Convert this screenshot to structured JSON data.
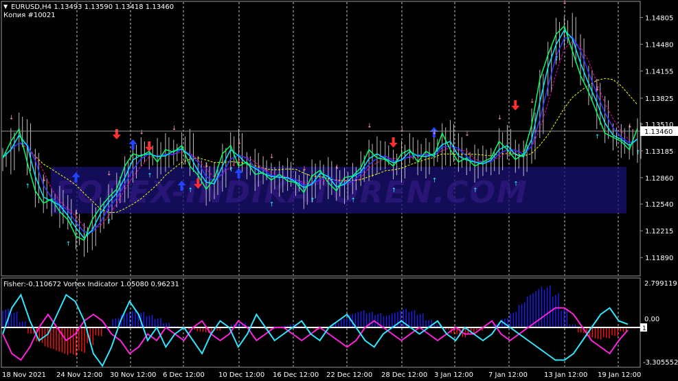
{
  "window": {
    "symbol_header": "EURUSD,H4  1.13493 1.13590 1.13418 1.13460",
    "copy_label": "Копия #10021",
    "current_price": "1.13460",
    "watermark": "FOREX-INDIKATOREN.COM"
  },
  "price_axis": [
    "1.14805",
    "1.14480",
    "1.14155",
    "1.13825",
    "1.13510",
    "1.13185",
    "1.12860",
    "1.12540",
    "1.12215",
    "1.11890"
  ],
  "indicator": {
    "header": "Fisher:-0.110672  Vortex Indicator 1.05080 0.96231",
    "axis": [
      "2.799119",
      "0.00",
      "1",
      "-3.305552"
    ]
  },
  "time_axis": [
    "18 Nov 2021",
    "24 Nov 12:00",
    "30 Nov 12:00",
    "6 Dec 12:00",
    "10 Dec 12:00",
    "16 Dec 12:00",
    "22 Dec 12:00",
    "28 Dec 12:00",
    "3 Jan 12:00",
    "7 Jan 12:00",
    "13 Jan 12:00",
    "19 Jan 12:00"
  ],
  "colors": {
    "background": "#000000",
    "grid": "#c8c8c8",
    "candles": "#bfbfbf",
    "ma_fast": "#00ff66",
    "ma_mid": "#00e5ff",
    "ma_slow": "#ffff00",
    "ma_pink": "#ff00aa",
    "ma_blue": "#3333ff",
    "fisher_up": "#1e1eff",
    "fisher_down": "#ff1111",
    "vortex_plus": "#33e6ff",
    "vortex_minus": "#ff22dd",
    "arrow_sell": "#ff3030",
    "arrow_buy": "#2244ff",
    "small_arrow_up": "#33e6ff",
    "small_arrow_down": "#ff99aa"
  },
  "chart_data": {
    "type": "line",
    "title": "EURUSD,H4",
    "ylim": [
      1.117,
      1.1495
    ],
    "close": [
      1.131,
      1.133,
      1.1345,
      1.1305,
      1.127,
      1.1255,
      1.126,
      1.1245,
      1.1235,
      1.1215,
      1.121,
      1.1235,
      1.125,
      1.1262,
      1.1272,
      1.13,
      1.1315,
      1.1312,
      1.1318,
      1.1305,
      1.132,
      1.1317,
      1.1325,
      1.13,
      1.1289,
      1.1272,
      1.1285,
      1.1315,
      1.1325,
      1.13,
      1.1305,
      1.129,
      1.1292,
      1.1283,
      1.129,
      1.1282,
      1.128,
      1.1268,
      1.1288,
      1.1295,
      1.128,
      1.127,
      1.1286,
      1.1288,
      1.1298,
      1.132,
      1.131,
      1.1308,
      1.13,
      1.1315,
      1.132,
      1.1305,
      1.1318,
      1.1312,
      1.134,
      1.132,
      1.1305,
      1.131,
      1.13,
      1.1305,
      1.131,
      1.133,
      1.132,
      1.1308,
      1.1315,
      1.135,
      1.1405,
      1.1435,
      1.146,
      1.147,
      1.144,
      1.141,
      1.139,
      1.1365,
      1.134,
      1.1335,
      1.133,
      1.132,
      1.1346
    ],
    "fisher": [
      1.2,
      1.0,
      0.4,
      -0.6,
      -1.4,
      -1.9,
      -2.2,
      -2.5,
      -2.6,
      -2.3,
      -1.6,
      -0.8,
      0.1,
      0.6,
      0.9,
      1.1,
      1.0,
      0.8,
      0.6,
      0.3,
      0.1,
      0.0,
      -0.2,
      -0.4,
      -0.5,
      -0.3,
      0.0,
      0.2,
      0.3,
      0.1,
      -0.1,
      -0.2,
      -0.1,
      0.1,
      0.2,
      0.1,
      -0.1,
      -0.2,
      0.0,
      0.3,
      0.6,
      0.9,
      1.1,
      1.0,
      0.9,
      0.8,
      1.0,
      1.2,
      1.1,
      0.9,
      0.5,
      0.2,
      -0.2,
      -0.6,
      -0.9,
      -0.6,
      -0.3,
      -0.1,
      0.2,
      0.6,
      1.0,
      1.6,
      2.2,
      2.6,
      2.7,
      2.2,
      1.2,
      0.2,
      -0.5,
      -0.9,
      -1.1,
      -1.0,
      -0.8,
      -0.4,
      -0.1
    ],
    "vortex_plus": [
      0.9,
      1.3,
      1.5,
      1.1,
      0.8,
      0.9,
      1.2,
      1.5,
      1.4,
      1.1,
      0.6,
      0.4,
      0.7,
      1.1,
      1.4,
      1.2,
      0.8,
      1.0,
      0.7,
      0.9,
      1.0,
      0.8,
      0.6,
      0.9,
      1.1,
      1.0,
      0.7,
      0.9,
      1.2,
      1.0,
      0.8,
      0.9,
      1.0,
      1.1,
      0.9,
      0.8,
      1.0,
      1.1,
      1.2,
      1.0,
      0.8,
      0.7,
      0.9,
      1.0,
      1.1,
      1.0,
      0.9,
      1.0,
      1.1,
      0.9,
      0.8,
      1.0,
      0.9,
      0.8,
      0.9,
      1.1,
      1.0,
      0.9,
      0.8,
      0.7,
      0.6,
      0.5,
      0.5,
      0.6,
      0.8,
      1.0,
      1.2,
      1.3,
      1.1,
      1.05
    ],
    "vortex_minus": [
      0.9,
      0.6,
      0.5,
      0.7,
      1.0,
      1.2,
      1.0,
      0.8,
      0.9,
      1.1,
      1.2,
      1.1,
      0.9,
      0.8,
      0.6,
      0.7,
      0.9,
      0.8,
      1.0,
      0.9,
      0.8,
      1.0,
      1.1,
      0.9,
      0.8,
      0.9,
      1.1,
      1.0,
      0.8,
      0.9,
      1.0,
      1.0,
      0.9,
      0.8,
      0.9,
      1.0,
      0.9,
      0.8,
      0.7,
      0.8,
      1.0,
      1.1,
      1.0,
      0.9,
      0.8,
      0.9,
      1.0,
      0.9,
      0.8,
      0.9,
      1.0,
      0.9,
      0.9,
      1.0,
      1.1,
      0.9,
      0.8,
      0.9,
      1.0,
      1.1,
      1.2,
      1.3,
      1.3,
      1.2,
      1.0,
      0.8,
      0.7,
      0.6,
      0.8,
      0.96
    ],
    "sell_arrows": [
      1.1335,
      1.132,
      1.1275,
      1.1325,
      1.137
    ],
    "buy_arrows": [
      1.129,
      1.133,
      1.128,
      1.1295,
      1.1345
    ]
  }
}
